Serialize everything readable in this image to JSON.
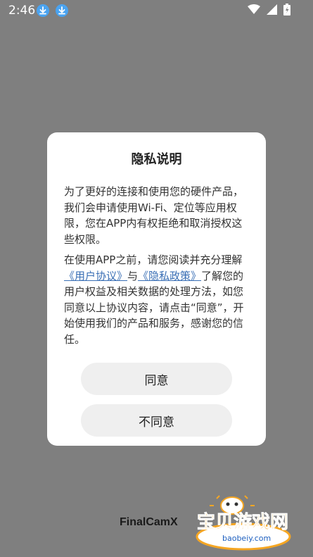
{
  "status_bar": {
    "time": "2:46",
    "icons": [
      "download-icon",
      "download-icon",
      "wifi-icon",
      "signal-icon",
      "battery-icon"
    ]
  },
  "dialog": {
    "title": "隐私说明",
    "paragraph1": "为了更好的连接和使用您的硬件产品，我们会申请使用Wi-Fi、定位等应用权限，您在APP内有权拒绝和取消授权这些权限。",
    "paragraph2_prefix": "在使用APP之前，请您阅读并充分理解",
    "user_agreement_link": "《用户协议》",
    "paragraph2_mid": "与",
    "privacy_policy_link": "《隐私政策》",
    "paragraph2_suffix": "了解您的用户权益及相关数据的处理方法，如您同意以上协议内容，请点击“同意”，开始使用我们的产品和服务，感谢您的信任。",
    "agree_button": "同意",
    "disagree_button": "不同意"
  },
  "footer": {
    "brand": "FinalCamX",
    "watermark_text": "宝贝游戏网",
    "watermark_url": "baobeiy.com"
  },
  "colors": {
    "overlay": "#7f7f7f",
    "link": "#3a6fb5",
    "button_bg": "#efefef",
    "download_badge": "#4aa3f0",
    "watermark_orange": "#f5a623"
  }
}
